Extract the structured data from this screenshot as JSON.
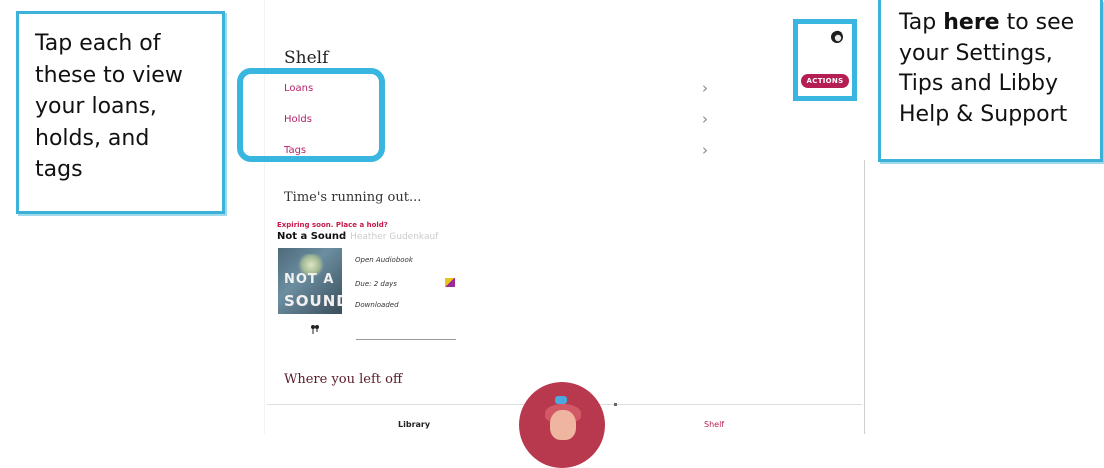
{
  "callouts": {
    "left": {
      "lines": [
        "Tap each of",
        "these to view",
        "your loans,",
        "holds, and",
        "tags"
      ]
    },
    "right": {
      "line1_prefix": "Tap ",
      "line1_bold": "here",
      "line1_suffix": " to see",
      "line2": "your Settings,",
      "line3": "Tips and Libby",
      "line4": "Help & Support"
    }
  },
  "header": {
    "title": "Shelf",
    "actions_label": "ACTIONS",
    "avatar_icon": "user-avatar-icon"
  },
  "nav": {
    "items": [
      {
        "label": "Loans",
        "chevron": "›"
      },
      {
        "label": "Holds",
        "chevron": "›"
      },
      {
        "label": "Tags",
        "chevron": "›"
      }
    ]
  },
  "sections": {
    "time_running_out": "Time's running out...",
    "where_you_left_off": "Where you left off"
  },
  "loan": {
    "expiring_text": "Expiring soon. Place a hold?",
    "title": "Not a Sound",
    "author": "- Heather Gudenkauf",
    "cover_text_1": "NOT A",
    "cover_text_2": "SOUND",
    "open_action": "Open Audiobook",
    "due_text": "Due: 2 days",
    "status": "Downloaded"
  },
  "bottom_nav": {
    "library_label": "Library",
    "shelf_label": "Shelf"
  },
  "colors": {
    "accent": "#b41e52",
    "highlight": "#38b6e0"
  }
}
